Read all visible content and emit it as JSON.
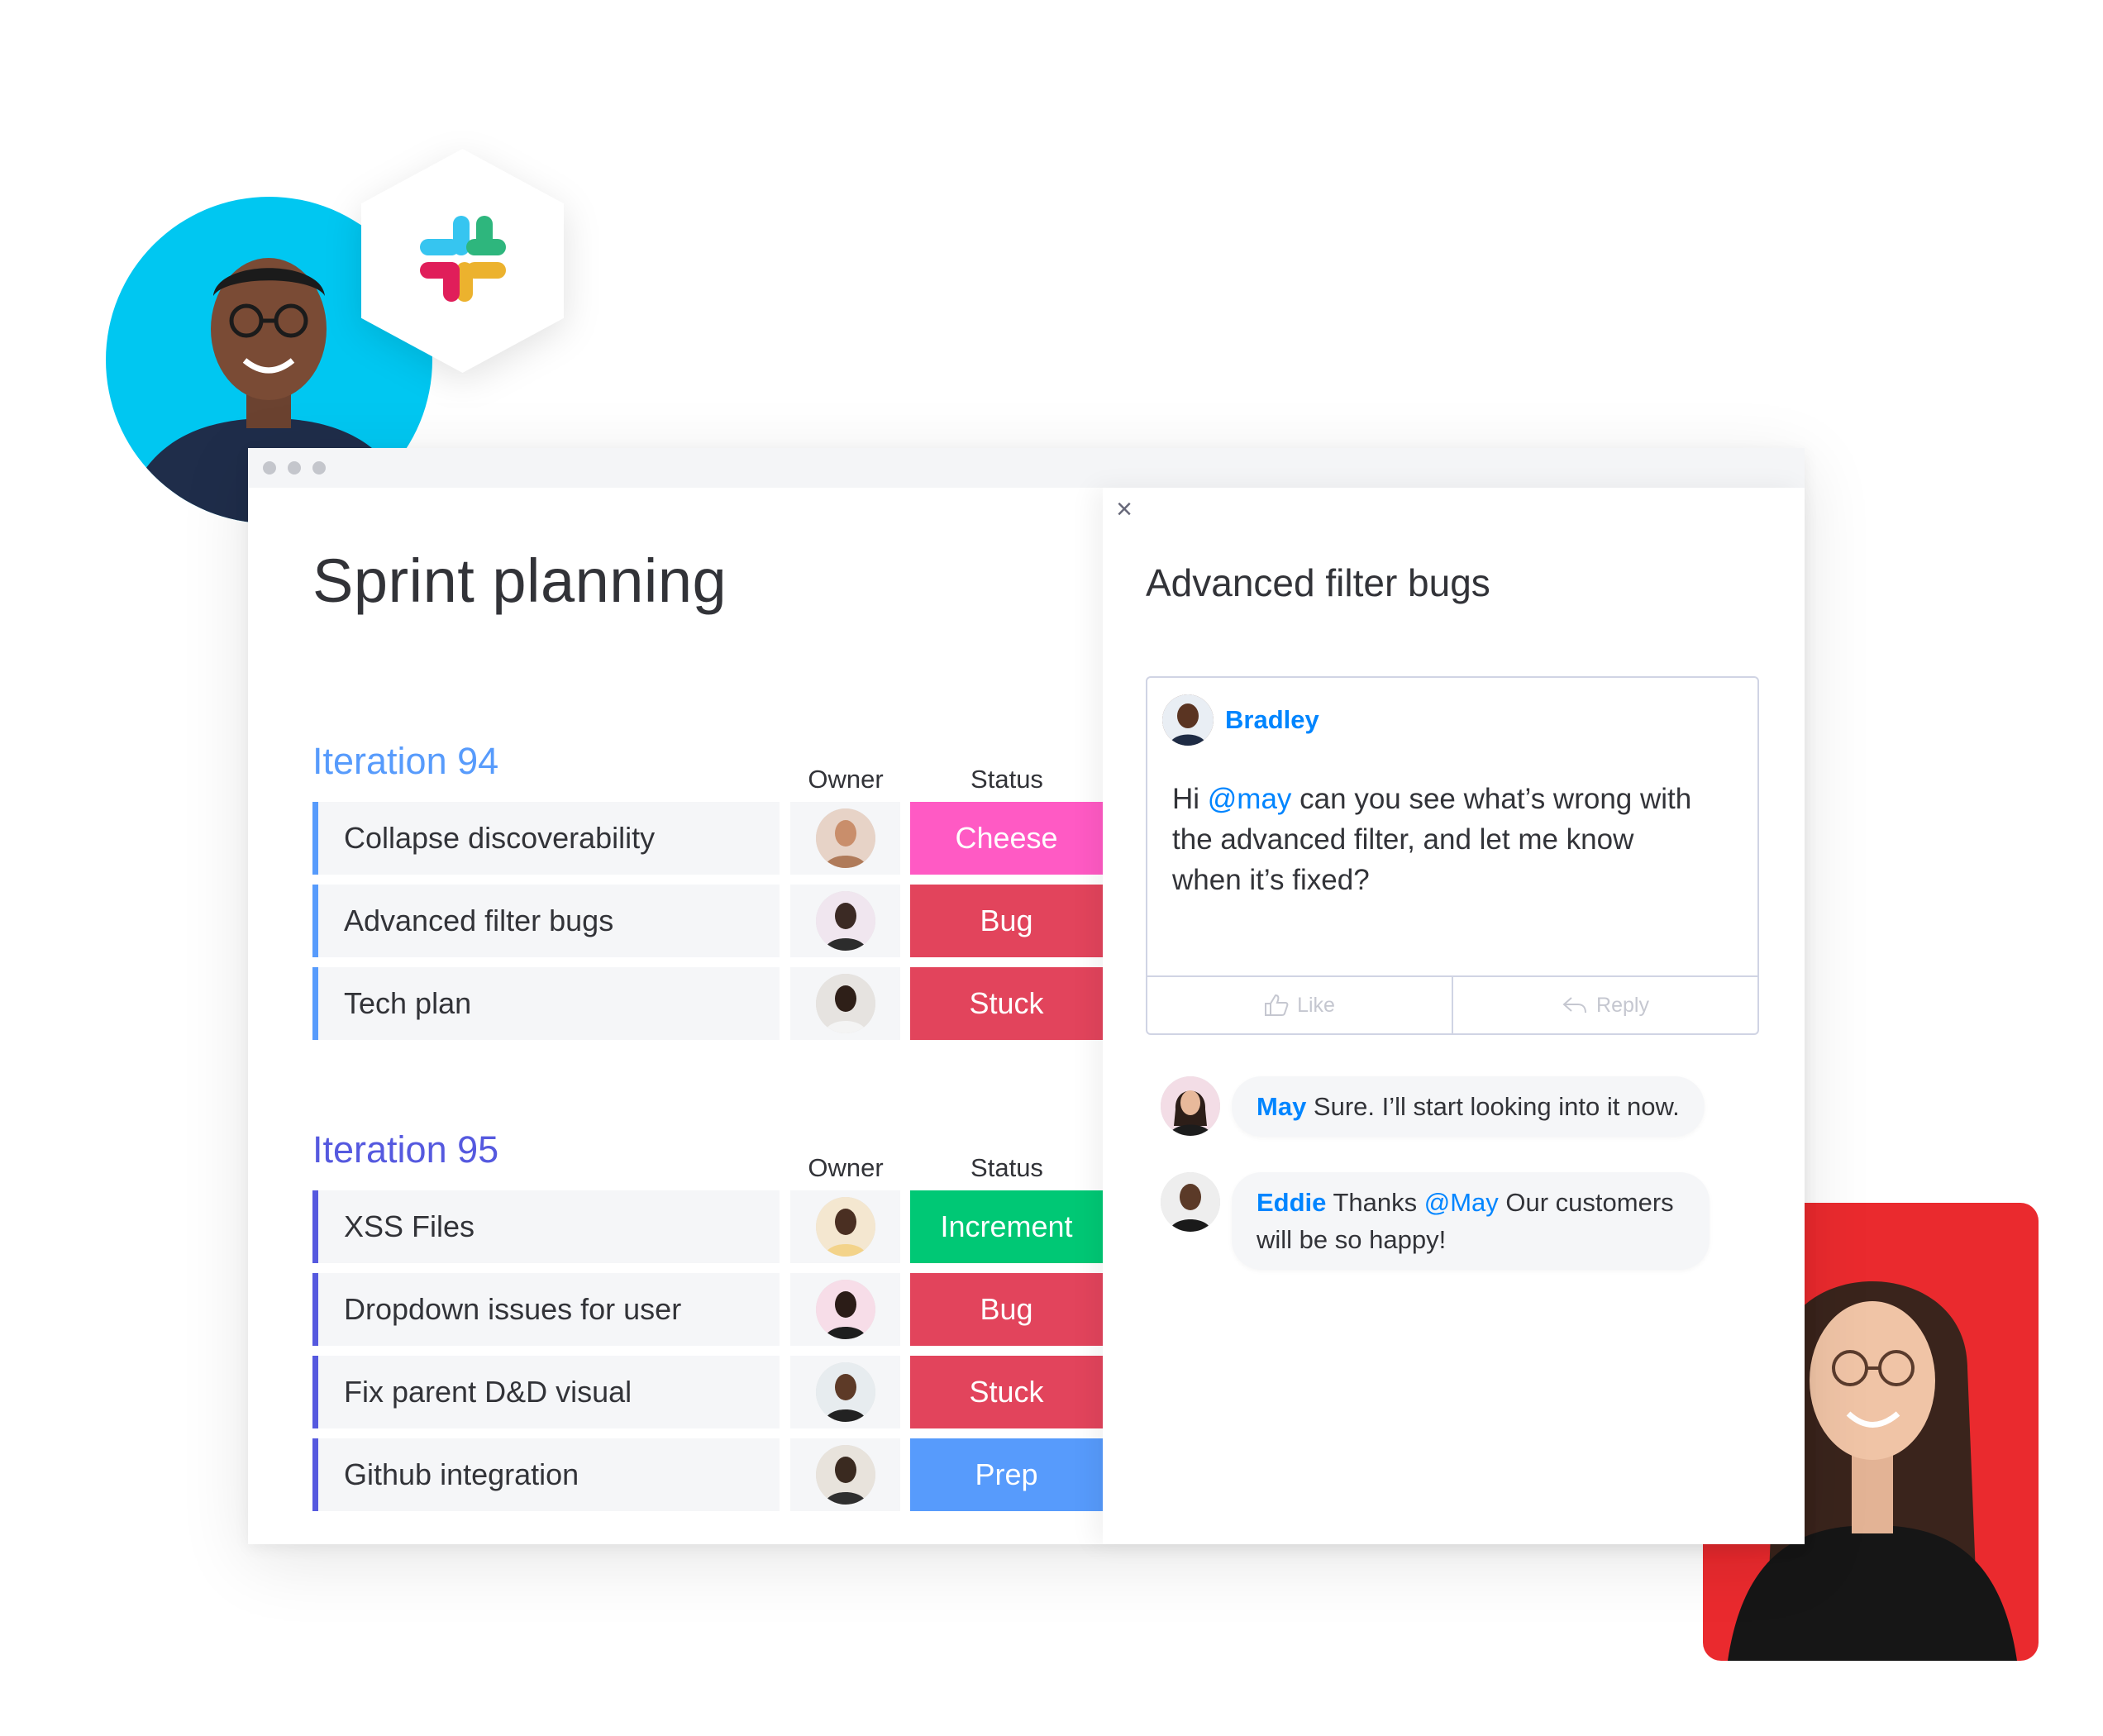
{
  "board": {
    "title": "Sprint planning",
    "groups": [
      {
        "title": "Iteration 94",
        "color": "#579bfc",
        "owner_header": "Owner",
        "status_header": "Status",
        "items": [
          {
            "name": "Collapse discoverability",
            "status": "Cheese",
            "status_color": "#ff5ac4"
          },
          {
            "name": "Advanced filter bugs",
            "status": "Bug",
            "status_color": "#e2445c"
          },
          {
            "name": "Tech plan",
            "status": "Stuck",
            "status_color": "#e2445c"
          }
        ]
      },
      {
        "title": "Iteration 95",
        "color": "#5559df",
        "owner_header": "Owner",
        "status_header": "Status",
        "items": [
          {
            "name": "XSS Files",
            "status": "Increment",
            "status_color": "#00c875"
          },
          {
            "name": "Dropdown issues for user",
            "status": "Bug",
            "status_color": "#e2445c"
          },
          {
            "name": "Fix parent D&D visual",
            "status": "Stuck",
            "status_color": "#e2445c"
          },
          {
            "name": "Github integration",
            "status": "Prep",
            "status_color": "#579bfc"
          }
        ]
      }
    ]
  },
  "panel": {
    "close_icon": "×",
    "title": "Advanced filter bugs",
    "post": {
      "author": "Bradley",
      "text_before": "Hi ",
      "mention": "@may",
      "text_after": " can you see what’s wrong with the advanced filter, and let me know when it’s fixed?",
      "like_label": "Like",
      "reply_label": "Reply"
    },
    "replies": [
      {
        "author": "May",
        "text_before": " Sure. I’ll start looking into it now.",
        "mention": "",
        "text_after": ""
      },
      {
        "author": "Eddie",
        "text_before": " Thanks ",
        "mention": "@May",
        "text_after": " Our customers will be so happy!"
      }
    ]
  },
  "colors": {
    "accent": "#0085ff",
    "slack_blue": "#36c5f0",
    "slack_green": "#2eb67d",
    "slack_yellow": "#ecb22e",
    "slack_red": "#e01e5a"
  },
  "icons": {
    "slack": "slack-logo-icon",
    "like": "thumbs-up-icon",
    "reply": "reply-arrow-icon",
    "close": "close-icon"
  }
}
